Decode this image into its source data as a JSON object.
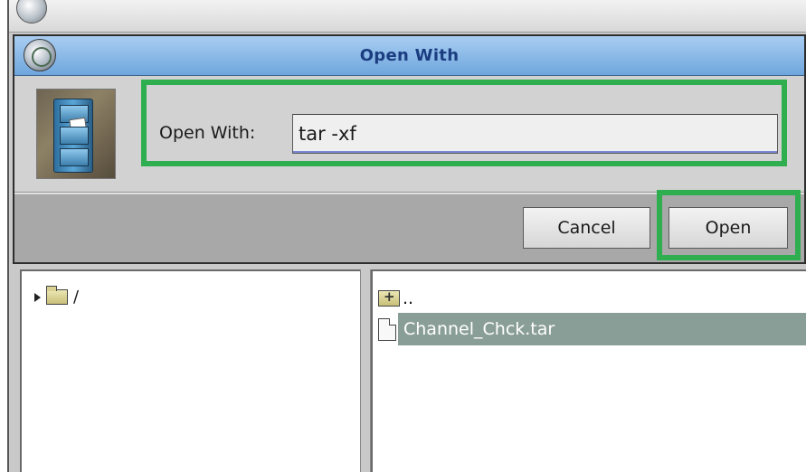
{
  "dialog": {
    "title": "Open With",
    "field_label": "Open With:",
    "command_value": "tar -xf",
    "cancel_label": "Cancel",
    "open_label": "Open"
  },
  "tree": {
    "root_label": "/"
  },
  "file_list": {
    "parent_label": "..",
    "selected_file": "Channel_Chck.tar"
  },
  "colors": {
    "highlight_box": "#2fae4f",
    "titlebar": "#8ab9e8",
    "title_text": "#1b3d80",
    "selection": "#8a9e98"
  }
}
